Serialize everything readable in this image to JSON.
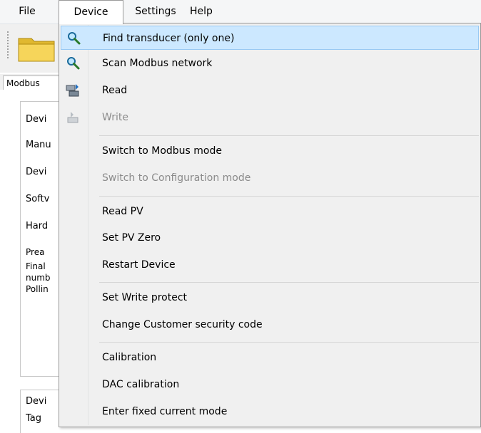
{
  "menubar": {
    "file": "File",
    "device": "Device",
    "settings": "Settings",
    "help": "Help"
  },
  "background": {
    "tab_label": "Modbus",
    "group1_title": "Devi",
    "group2_title": "Devi",
    "rows": [
      "Manu",
      "Devi",
      "Softv",
      "Hard",
      "Prea",
      "Final",
      "numb",
      "Pollin"
    ],
    "tag_label": "Tag"
  },
  "device_menu": {
    "items": [
      {
        "label": "Find transducer (only one)",
        "icon": "magnifier-icon",
        "enabled": true,
        "highlighted": true
      },
      {
        "label": "Scan Modbus network",
        "icon": "magnifier-icon",
        "enabled": true
      },
      {
        "label": "Read",
        "icon": "read-device-icon",
        "enabled": true
      },
      {
        "label": "Write",
        "icon": "write-device-icon",
        "enabled": false
      },
      {
        "label": "Switch to Modbus mode",
        "enabled": true
      },
      {
        "label": "Switch to Configuration mode",
        "enabled": false
      },
      {
        "label": "Read PV",
        "enabled": true
      },
      {
        "label": "Set PV Zero",
        "enabled": true
      },
      {
        "label": "Restart Device",
        "enabled": true
      },
      {
        "label": "Set Write protect",
        "enabled": true
      },
      {
        "label": "Change Customer security code",
        "enabled": true
      },
      {
        "label": "Calibration",
        "enabled": true
      },
      {
        "label": "DAC calibration",
        "enabled": true
      },
      {
        "label": "Enter fixed current mode",
        "enabled": true
      }
    ]
  },
  "colors": {
    "highlight_fill": "#cce8ff",
    "highlight_border": "#99c9f3",
    "disabled_text": "#8b8b8b",
    "menu_bg": "#f0f0f0"
  }
}
